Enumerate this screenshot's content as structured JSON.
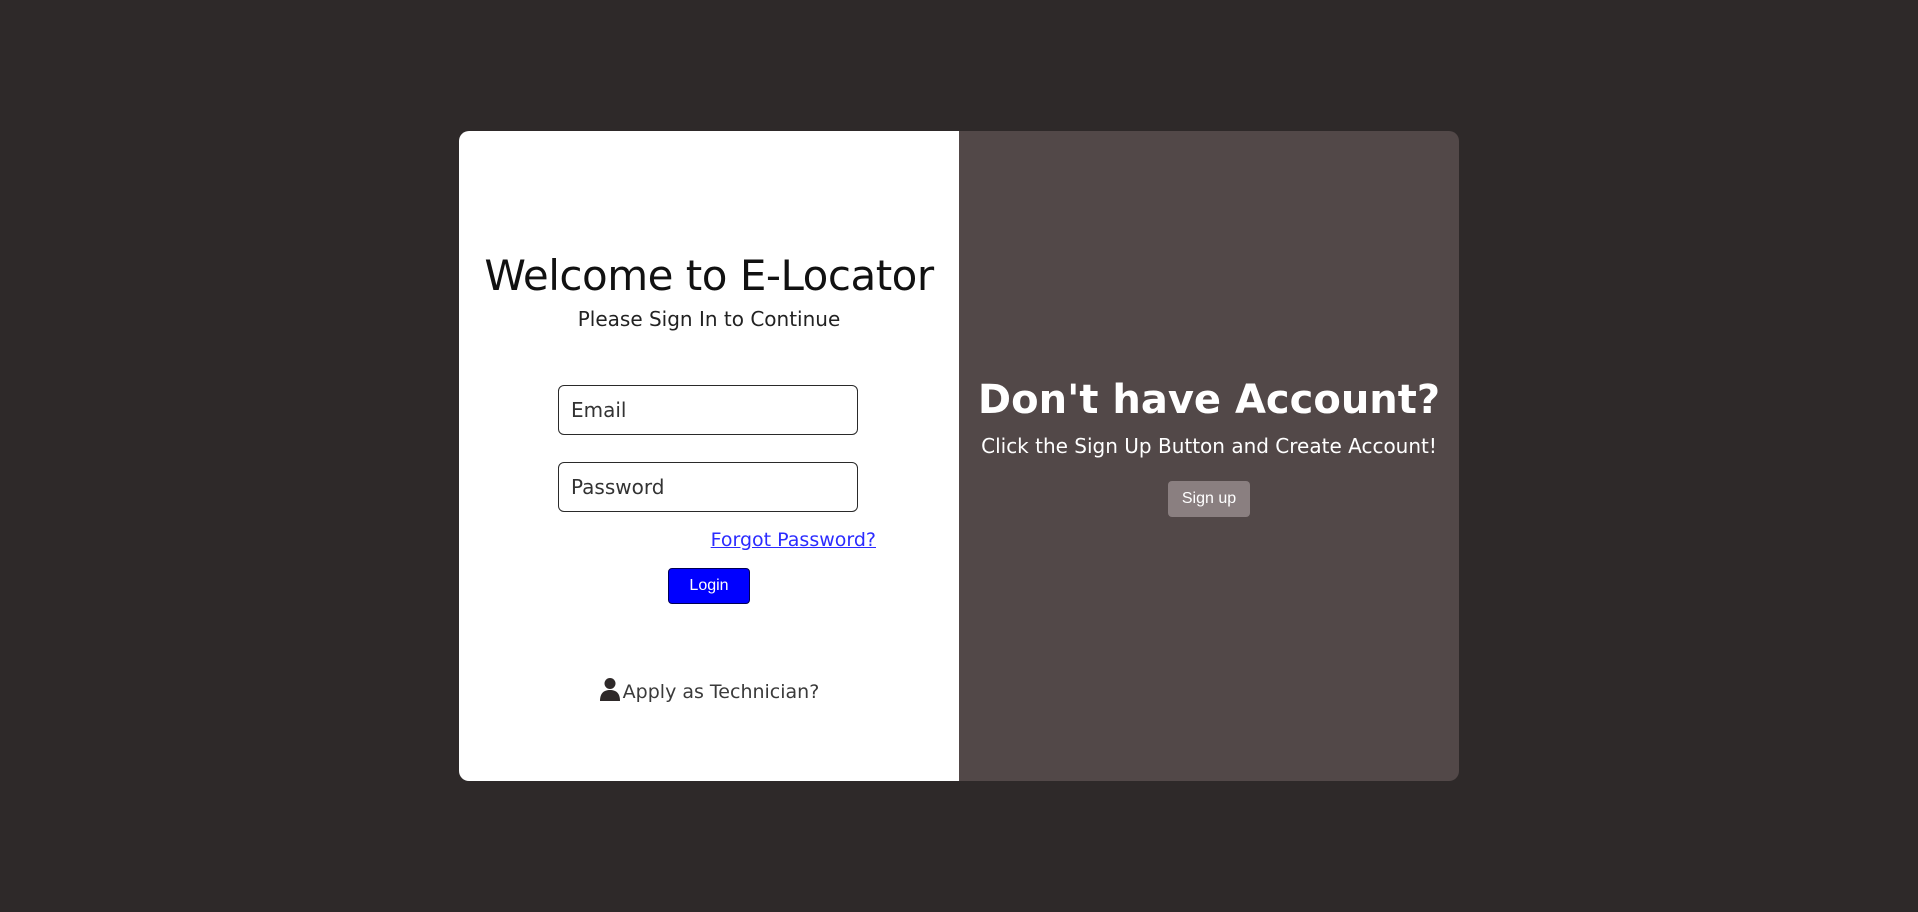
{
  "colors": {
    "page_background": "#2e2929",
    "left_panel": "#ffffff",
    "right_panel": "#524848",
    "login_button": "#0000ff",
    "signup_button": "#8a7f80",
    "link": "#2b2bff"
  },
  "login": {
    "title": "Welcome to E-Locator",
    "subtitle": "Please Sign In to Continue",
    "email_placeholder": "Email",
    "password_placeholder": "Password",
    "forgot_label": "Forgot Password?",
    "login_label": "Login",
    "apply_icon": "user-icon",
    "apply_label": "Apply as Technician?"
  },
  "signup": {
    "title": "Don't have Account?",
    "subtitle": "Click the Sign Up Button and Create Account!",
    "button_label": "Sign up"
  }
}
